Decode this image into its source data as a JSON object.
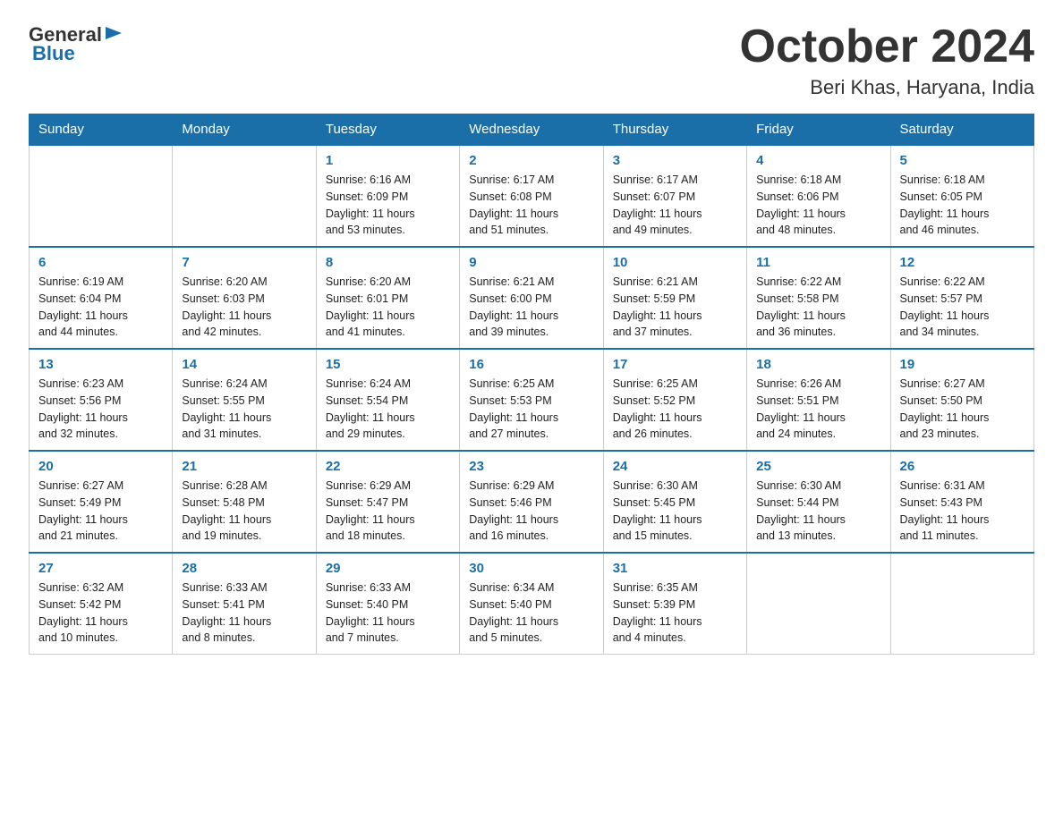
{
  "header": {
    "logo_general": "General",
    "logo_blue": "Blue",
    "title": "October 2024",
    "subtitle": "Beri Khas, Haryana, India"
  },
  "days_of_week": [
    "Sunday",
    "Monday",
    "Tuesday",
    "Wednesday",
    "Thursday",
    "Friday",
    "Saturday"
  ],
  "weeks": [
    [
      {
        "day": "",
        "info": ""
      },
      {
        "day": "",
        "info": ""
      },
      {
        "day": "1",
        "info": "Sunrise: 6:16 AM\nSunset: 6:09 PM\nDaylight: 11 hours\nand 53 minutes."
      },
      {
        "day": "2",
        "info": "Sunrise: 6:17 AM\nSunset: 6:08 PM\nDaylight: 11 hours\nand 51 minutes."
      },
      {
        "day": "3",
        "info": "Sunrise: 6:17 AM\nSunset: 6:07 PM\nDaylight: 11 hours\nand 49 minutes."
      },
      {
        "day": "4",
        "info": "Sunrise: 6:18 AM\nSunset: 6:06 PM\nDaylight: 11 hours\nand 48 minutes."
      },
      {
        "day": "5",
        "info": "Sunrise: 6:18 AM\nSunset: 6:05 PM\nDaylight: 11 hours\nand 46 minutes."
      }
    ],
    [
      {
        "day": "6",
        "info": "Sunrise: 6:19 AM\nSunset: 6:04 PM\nDaylight: 11 hours\nand 44 minutes."
      },
      {
        "day": "7",
        "info": "Sunrise: 6:20 AM\nSunset: 6:03 PM\nDaylight: 11 hours\nand 42 minutes."
      },
      {
        "day": "8",
        "info": "Sunrise: 6:20 AM\nSunset: 6:01 PM\nDaylight: 11 hours\nand 41 minutes."
      },
      {
        "day": "9",
        "info": "Sunrise: 6:21 AM\nSunset: 6:00 PM\nDaylight: 11 hours\nand 39 minutes."
      },
      {
        "day": "10",
        "info": "Sunrise: 6:21 AM\nSunset: 5:59 PM\nDaylight: 11 hours\nand 37 minutes."
      },
      {
        "day": "11",
        "info": "Sunrise: 6:22 AM\nSunset: 5:58 PM\nDaylight: 11 hours\nand 36 minutes."
      },
      {
        "day": "12",
        "info": "Sunrise: 6:22 AM\nSunset: 5:57 PM\nDaylight: 11 hours\nand 34 minutes."
      }
    ],
    [
      {
        "day": "13",
        "info": "Sunrise: 6:23 AM\nSunset: 5:56 PM\nDaylight: 11 hours\nand 32 minutes."
      },
      {
        "day": "14",
        "info": "Sunrise: 6:24 AM\nSunset: 5:55 PM\nDaylight: 11 hours\nand 31 minutes."
      },
      {
        "day": "15",
        "info": "Sunrise: 6:24 AM\nSunset: 5:54 PM\nDaylight: 11 hours\nand 29 minutes."
      },
      {
        "day": "16",
        "info": "Sunrise: 6:25 AM\nSunset: 5:53 PM\nDaylight: 11 hours\nand 27 minutes."
      },
      {
        "day": "17",
        "info": "Sunrise: 6:25 AM\nSunset: 5:52 PM\nDaylight: 11 hours\nand 26 minutes."
      },
      {
        "day": "18",
        "info": "Sunrise: 6:26 AM\nSunset: 5:51 PM\nDaylight: 11 hours\nand 24 minutes."
      },
      {
        "day": "19",
        "info": "Sunrise: 6:27 AM\nSunset: 5:50 PM\nDaylight: 11 hours\nand 23 minutes."
      }
    ],
    [
      {
        "day": "20",
        "info": "Sunrise: 6:27 AM\nSunset: 5:49 PM\nDaylight: 11 hours\nand 21 minutes."
      },
      {
        "day": "21",
        "info": "Sunrise: 6:28 AM\nSunset: 5:48 PM\nDaylight: 11 hours\nand 19 minutes."
      },
      {
        "day": "22",
        "info": "Sunrise: 6:29 AM\nSunset: 5:47 PM\nDaylight: 11 hours\nand 18 minutes."
      },
      {
        "day": "23",
        "info": "Sunrise: 6:29 AM\nSunset: 5:46 PM\nDaylight: 11 hours\nand 16 minutes."
      },
      {
        "day": "24",
        "info": "Sunrise: 6:30 AM\nSunset: 5:45 PM\nDaylight: 11 hours\nand 15 minutes."
      },
      {
        "day": "25",
        "info": "Sunrise: 6:30 AM\nSunset: 5:44 PM\nDaylight: 11 hours\nand 13 minutes."
      },
      {
        "day": "26",
        "info": "Sunrise: 6:31 AM\nSunset: 5:43 PM\nDaylight: 11 hours\nand 11 minutes."
      }
    ],
    [
      {
        "day": "27",
        "info": "Sunrise: 6:32 AM\nSunset: 5:42 PM\nDaylight: 11 hours\nand 10 minutes."
      },
      {
        "day": "28",
        "info": "Sunrise: 6:33 AM\nSunset: 5:41 PM\nDaylight: 11 hours\nand 8 minutes."
      },
      {
        "day": "29",
        "info": "Sunrise: 6:33 AM\nSunset: 5:40 PM\nDaylight: 11 hours\nand 7 minutes."
      },
      {
        "day": "30",
        "info": "Sunrise: 6:34 AM\nSunset: 5:40 PM\nDaylight: 11 hours\nand 5 minutes."
      },
      {
        "day": "31",
        "info": "Sunrise: 6:35 AM\nSunset: 5:39 PM\nDaylight: 11 hours\nand 4 minutes."
      },
      {
        "day": "",
        "info": ""
      },
      {
        "day": "",
        "info": ""
      }
    ]
  ]
}
